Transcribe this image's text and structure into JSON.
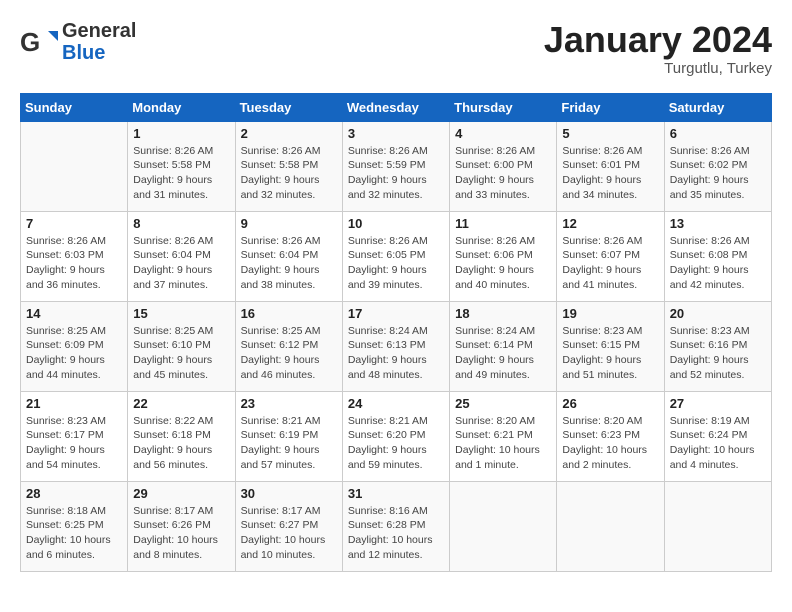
{
  "logo": {
    "general": "General",
    "blue": "Blue"
  },
  "title": "January 2024",
  "location": "Turgutlu, Turkey",
  "headers": [
    "Sunday",
    "Monday",
    "Tuesday",
    "Wednesday",
    "Thursday",
    "Friday",
    "Saturday"
  ],
  "weeks": [
    [
      {
        "day": "",
        "sunrise": "",
        "sunset": "",
        "daylight": ""
      },
      {
        "day": "1",
        "sunrise": "Sunrise: 8:26 AM",
        "sunset": "Sunset: 5:58 PM",
        "daylight": "Daylight: 9 hours and 31 minutes."
      },
      {
        "day": "2",
        "sunrise": "Sunrise: 8:26 AM",
        "sunset": "Sunset: 5:58 PM",
        "daylight": "Daylight: 9 hours and 32 minutes."
      },
      {
        "day": "3",
        "sunrise": "Sunrise: 8:26 AM",
        "sunset": "Sunset: 5:59 PM",
        "daylight": "Daylight: 9 hours and 32 minutes."
      },
      {
        "day": "4",
        "sunrise": "Sunrise: 8:26 AM",
        "sunset": "Sunset: 6:00 PM",
        "daylight": "Daylight: 9 hours and 33 minutes."
      },
      {
        "day": "5",
        "sunrise": "Sunrise: 8:26 AM",
        "sunset": "Sunset: 6:01 PM",
        "daylight": "Daylight: 9 hours and 34 minutes."
      },
      {
        "day": "6",
        "sunrise": "Sunrise: 8:26 AM",
        "sunset": "Sunset: 6:02 PM",
        "daylight": "Daylight: 9 hours and 35 minutes."
      }
    ],
    [
      {
        "day": "7",
        "sunrise": "Sunrise: 8:26 AM",
        "sunset": "Sunset: 6:03 PM",
        "daylight": "Daylight: 9 hours and 36 minutes."
      },
      {
        "day": "8",
        "sunrise": "Sunrise: 8:26 AM",
        "sunset": "Sunset: 6:04 PM",
        "daylight": "Daylight: 9 hours and 37 minutes."
      },
      {
        "day": "9",
        "sunrise": "Sunrise: 8:26 AM",
        "sunset": "Sunset: 6:04 PM",
        "daylight": "Daylight: 9 hours and 38 minutes."
      },
      {
        "day": "10",
        "sunrise": "Sunrise: 8:26 AM",
        "sunset": "Sunset: 6:05 PM",
        "daylight": "Daylight: 9 hours and 39 minutes."
      },
      {
        "day": "11",
        "sunrise": "Sunrise: 8:26 AM",
        "sunset": "Sunset: 6:06 PM",
        "daylight": "Daylight: 9 hours and 40 minutes."
      },
      {
        "day": "12",
        "sunrise": "Sunrise: 8:26 AM",
        "sunset": "Sunset: 6:07 PM",
        "daylight": "Daylight: 9 hours and 41 minutes."
      },
      {
        "day": "13",
        "sunrise": "Sunrise: 8:26 AM",
        "sunset": "Sunset: 6:08 PM",
        "daylight": "Daylight: 9 hours and 42 minutes."
      }
    ],
    [
      {
        "day": "14",
        "sunrise": "Sunrise: 8:25 AM",
        "sunset": "Sunset: 6:09 PM",
        "daylight": "Daylight: 9 hours and 44 minutes."
      },
      {
        "day": "15",
        "sunrise": "Sunrise: 8:25 AM",
        "sunset": "Sunset: 6:10 PM",
        "daylight": "Daylight: 9 hours and 45 minutes."
      },
      {
        "day": "16",
        "sunrise": "Sunrise: 8:25 AM",
        "sunset": "Sunset: 6:12 PM",
        "daylight": "Daylight: 9 hours and 46 minutes."
      },
      {
        "day": "17",
        "sunrise": "Sunrise: 8:24 AM",
        "sunset": "Sunset: 6:13 PM",
        "daylight": "Daylight: 9 hours and 48 minutes."
      },
      {
        "day": "18",
        "sunrise": "Sunrise: 8:24 AM",
        "sunset": "Sunset: 6:14 PM",
        "daylight": "Daylight: 9 hours and 49 minutes."
      },
      {
        "day": "19",
        "sunrise": "Sunrise: 8:23 AM",
        "sunset": "Sunset: 6:15 PM",
        "daylight": "Daylight: 9 hours and 51 minutes."
      },
      {
        "day": "20",
        "sunrise": "Sunrise: 8:23 AM",
        "sunset": "Sunset: 6:16 PM",
        "daylight": "Daylight: 9 hours and 52 minutes."
      }
    ],
    [
      {
        "day": "21",
        "sunrise": "Sunrise: 8:23 AM",
        "sunset": "Sunset: 6:17 PM",
        "daylight": "Daylight: 9 hours and 54 minutes."
      },
      {
        "day": "22",
        "sunrise": "Sunrise: 8:22 AM",
        "sunset": "Sunset: 6:18 PM",
        "daylight": "Daylight: 9 hours and 56 minutes."
      },
      {
        "day": "23",
        "sunrise": "Sunrise: 8:21 AM",
        "sunset": "Sunset: 6:19 PM",
        "daylight": "Daylight: 9 hours and 57 minutes."
      },
      {
        "day": "24",
        "sunrise": "Sunrise: 8:21 AM",
        "sunset": "Sunset: 6:20 PM",
        "daylight": "Daylight: 9 hours and 59 minutes."
      },
      {
        "day": "25",
        "sunrise": "Sunrise: 8:20 AM",
        "sunset": "Sunset: 6:21 PM",
        "daylight": "Daylight: 10 hours and 1 minute."
      },
      {
        "day": "26",
        "sunrise": "Sunrise: 8:20 AM",
        "sunset": "Sunset: 6:23 PM",
        "daylight": "Daylight: 10 hours and 2 minutes."
      },
      {
        "day": "27",
        "sunrise": "Sunrise: 8:19 AM",
        "sunset": "Sunset: 6:24 PM",
        "daylight": "Daylight: 10 hours and 4 minutes."
      }
    ],
    [
      {
        "day": "28",
        "sunrise": "Sunrise: 8:18 AM",
        "sunset": "Sunset: 6:25 PM",
        "daylight": "Daylight: 10 hours and 6 minutes."
      },
      {
        "day": "29",
        "sunrise": "Sunrise: 8:17 AM",
        "sunset": "Sunset: 6:26 PM",
        "daylight": "Daylight: 10 hours and 8 minutes."
      },
      {
        "day": "30",
        "sunrise": "Sunrise: 8:17 AM",
        "sunset": "Sunset: 6:27 PM",
        "daylight": "Daylight: 10 hours and 10 minutes."
      },
      {
        "day": "31",
        "sunrise": "Sunrise: 8:16 AM",
        "sunset": "Sunset: 6:28 PM",
        "daylight": "Daylight: 10 hours and 12 minutes."
      },
      {
        "day": "",
        "sunrise": "",
        "sunset": "",
        "daylight": ""
      },
      {
        "day": "",
        "sunrise": "",
        "sunset": "",
        "daylight": ""
      },
      {
        "day": "",
        "sunrise": "",
        "sunset": "",
        "daylight": ""
      }
    ]
  ]
}
